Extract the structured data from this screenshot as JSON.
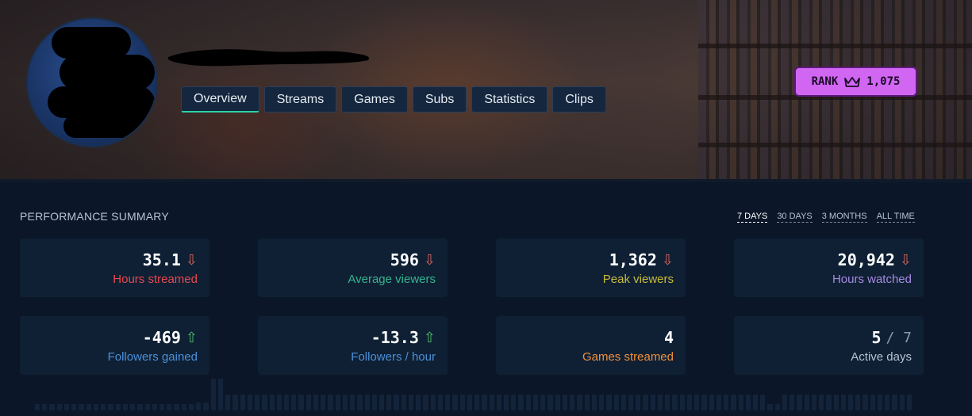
{
  "profile": {
    "tabs": [
      {
        "label": "Overview",
        "active": true
      },
      {
        "label": "Streams",
        "active": false
      },
      {
        "label": "Games",
        "active": false
      },
      {
        "label": "Subs",
        "active": false
      },
      {
        "label": "Statistics",
        "active": false
      },
      {
        "label": "Clips",
        "active": false
      }
    ],
    "rank": {
      "label": "RANK",
      "value": "1,075",
      "icon": "crown-icon",
      "color": "#d166f3"
    }
  },
  "performance": {
    "title": "PERFORMANCE SUMMARY",
    "ranges": [
      {
        "label": "7 DAYS",
        "active": true
      },
      {
        "label": "30 DAYS",
        "active": false
      },
      {
        "label": "3 MONTHS",
        "active": false
      },
      {
        "label": "ALL TIME",
        "active": false
      }
    ],
    "cards": [
      {
        "value": "35.1",
        "trend": "down",
        "label": "Hours streamed",
        "color": "#e8474f"
      },
      {
        "value": "596",
        "trend": "down",
        "label": "Average viewers",
        "color": "#35b48f"
      },
      {
        "value": "1,362",
        "trend": "down",
        "label": "Peak viewers",
        "color": "#c9bb3c"
      },
      {
        "value": "20,942",
        "trend": "down",
        "label": "Hours watched",
        "color": "#a58ae0"
      },
      {
        "value": "-469",
        "trend": "up",
        "label": "Followers gained",
        "color": "#4a90d9"
      },
      {
        "value": "-13.3",
        "trend": "up",
        "label": "Followers / hour",
        "color": "#4a90d9"
      },
      {
        "value": "4",
        "trend": "",
        "label": "Games streamed",
        "color": "#f0903a"
      },
      {
        "value": "5",
        "suffix": "/ 7",
        "trend": "",
        "label": "Active days",
        "color": "#b7c2d1"
      }
    ]
  }
}
